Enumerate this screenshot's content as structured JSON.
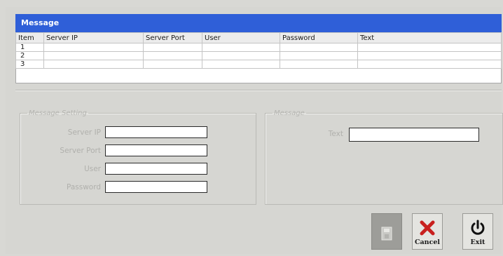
{
  "window": {
    "title": "Message"
  },
  "table": {
    "headers": [
      "Item",
      "Server IP",
      "Server Port",
      "User",
      "Password",
      "Text"
    ],
    "rows": [
      [
        "1",
        "",
        "",
        "",
        "",
        ""
      ],
      [
        "2",
        "",
        "",
        "",
        "",
        ""
      ],
      [
        "3",
        "",
        "",
        "",
        "",
        ""
      ]
    ]
  },
  "message_setting": {
    "legend": "Message Setting",
    "server_ip_label": "Server IP",
    "server_ip_value": "",
    "server_port_label": "Server Port",
    "server_port_value": "",
    "user_label": "User",
    "user_value": "",
    "password_label": "Password",
    "password_value": ""
  },
  "message": {
    "legend": "Message",
    "text_label": "Text",
    "text_value": ""
  },
  "buttons": {
    "save_icon": "save-icon",
    "cancel_label": "Cancel",
    "cancel_icon": "x-icon",
    "cancel_color": "#c8201e",
    "exit_label": "Exit",
    "exit_icon": "power-icon"
  }
}
